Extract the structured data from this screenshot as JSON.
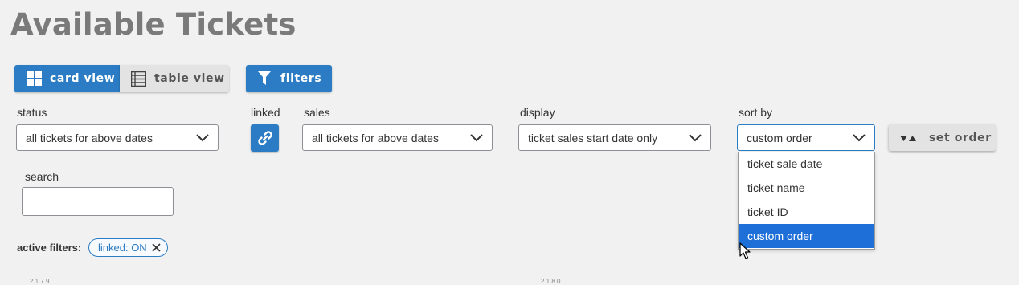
{
  "page": {
    "title": "Available Tickets"
  },
  "toolbar": {
    "card_view": "card view",
    "table_view": "table view",
    "filters": "filters"
  },
  "filters": {
    "status": {
      "label": "status",
      "value": "all tickets for above dates"
    },
    "linked": {
      "label": "linked"
    },
    "sales": {
      "label": "sales",
      "value": "all tickets for above dates"
    },
    "display": {
      "label": "display",
      "value": "ticket sales start date only"
    },
    "sort_by": {
      "label": "sort by",
      "value": "custom order",
      "options": [
        "ticket sale date",
        "ticket name",
        "ticket ID",
        "custom order"
      ]
    },
    "set_order": "set order",
    "search": {
      "label": "search",
      "value": ""
    }
  },
  "active_filters": {
    "label": "active filters:",
    "chips": [
      "linked: ON"
    ]
  },
  "footer": {
    "left_code": "2.1.7.9",
    "right_code": "2.1.8.0"
  },
  "colors": {
    "accent": "#2b7cc4",
    "selected": "#1e6fd8",
    "title": "#7a7a7a"
  }
}
